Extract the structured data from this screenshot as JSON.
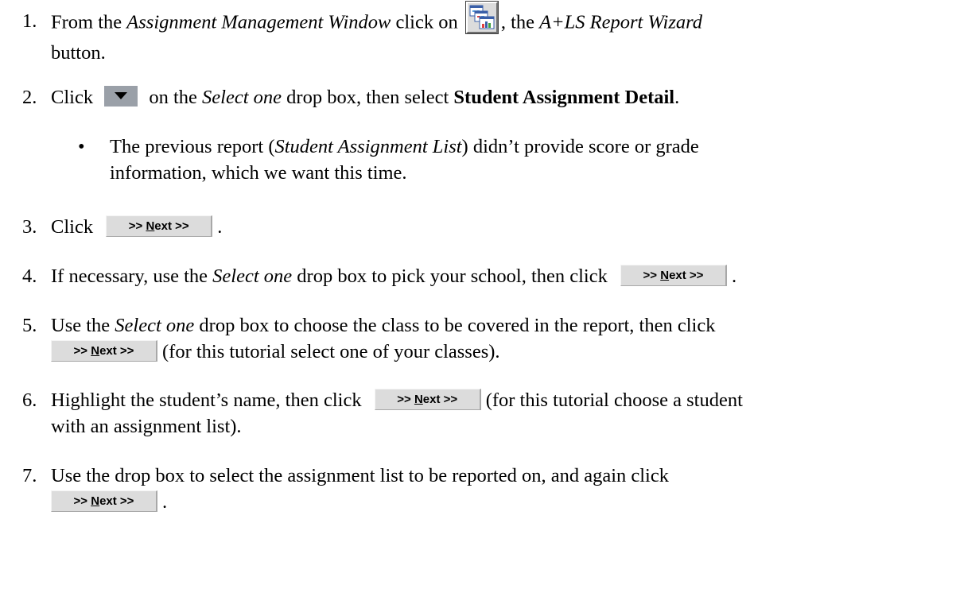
{
  "steps": [
    {
      "number": "1.",
      "lines": [
        [
          "From the ",
          "Assignment Management Window",
          " click on ",
          ", the ",
          "A+LS Report Wizard"
        ],
        [
          "button."
        ]
      ]
    },
    {
      "number": "2.",
      "parts": [
        "Click ",
        " on the ",
        "Select one",
        " drop box, then select ",
        "Student Assignment Detail",
        "."
      ]
    },
    {
      "number": "3.",
      "parts": [
        "Click ",
        "."
      ]
    },
    {
      "number": "4.",
      "parts": [
        "If necessary, use the ",
        "Select one",
        " drop box to pick your school, then click ",
        "."
      ]
    },
    {
      "number": "5.",
      "parts": [
        "Use the ",
        "Select one",
        " drop box to choose the class to be covered in the report, then click",
        "(for this tutorial select one of your classes)."
      ]
    },
    {
      "number": "6.",
      "parts": [
        "Highlight the student’s name, then click ",
        "(for this tutorial choose a student",
        "with an assignment list)."
      ]
    },
    {
      "number": "7.",
      "parts": [
        "Use the drop box to select the assignment list to be reported on, and again click",
        "."
      ]
    }
  ],
  "bullet": {
    "symbol": "•",
    "parts": [
      "The previous report (",
      "Student Assignment List",
      ") didn’t provide score or grade",
      "information, which we want this time."
    ]
  },
  "next_button": {
    "prefix": ">> ",
    "underlined": "N",
    "rest": "ext >>"
  },
  "icons": {
    "wizard": "report-wizard-icon",
    "dropdown": "dropdown-arrow-icon"
  }
}
